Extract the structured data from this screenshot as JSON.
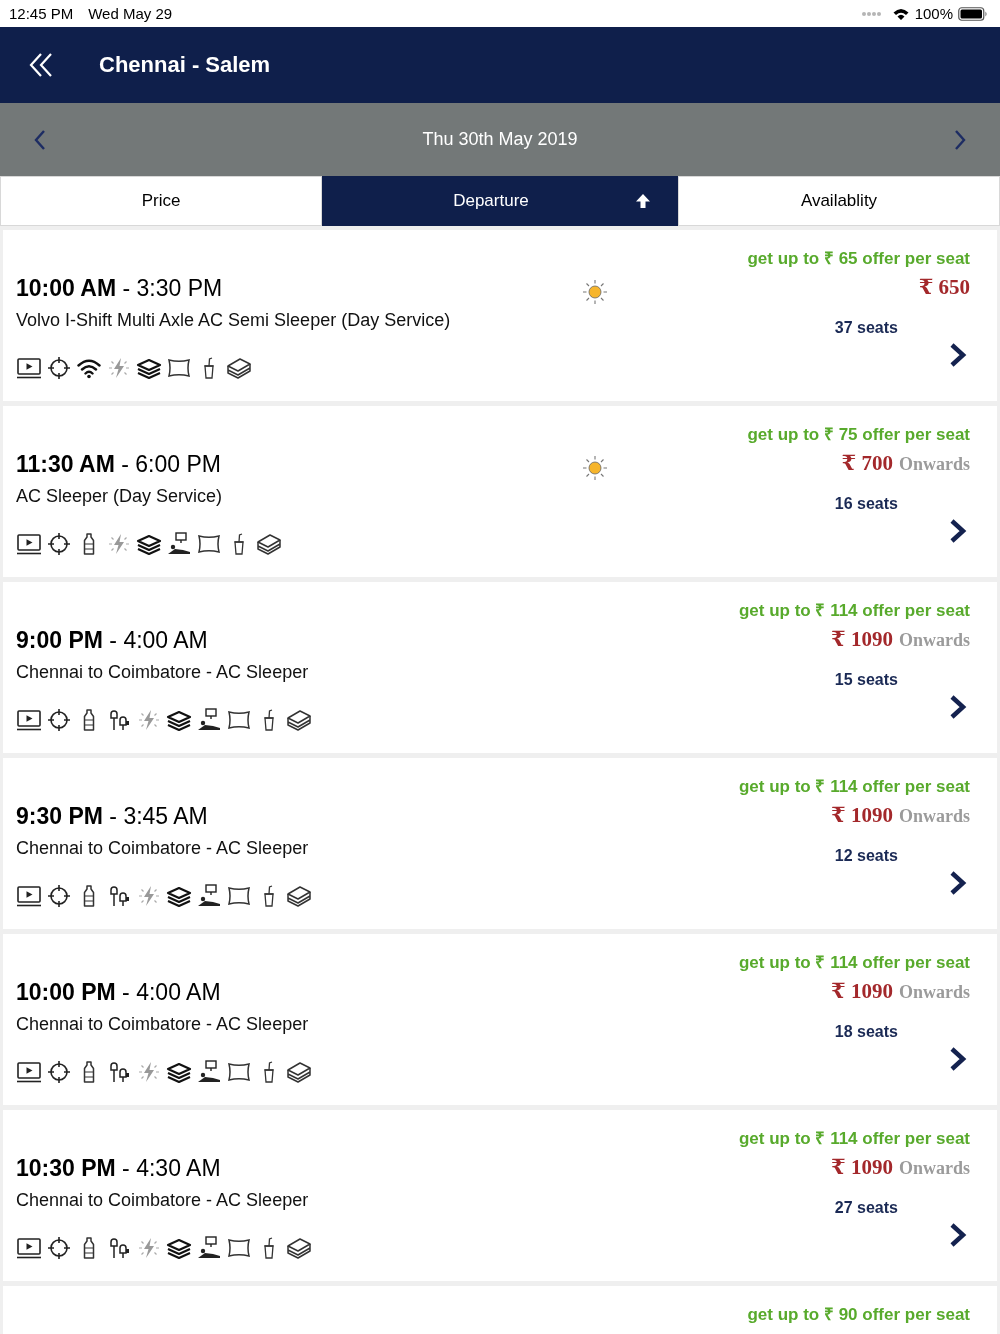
{
  "status_bar": {
    "time": "12:45 PM",
    "date": "Wed May 29",
    "battery": "100%"
  },
  "header": {
    "title": "Chennai - Salem"
  },
  "date_bar": {
    "date": "Thu 30th May 2019"
  },
  "tabs": [
    {
      "label": "Price",
      "selected": false
    },
    {
      "label": "Departure",
      "selected": true,
      "sort_ascending": true
    },
    {
      "label": "Availablity",
      "selected": false
    }
  ],
  "trips": [
    {
      "time": "**10:00 AM** - 3:30 PM",
      "bus": "Volvo I-Shift Multi Axle AC Semi Sleeper (Day Service)",
      "daytime": true,
      "amenities": [
        {
          "kind": "tv"
        },
        {
          "kind": "gps"
        },
        {
          "kind": "wifi"
        },
        {
          "kind": "charging"
        },
        {
          "kind": "blanket"
        },
        {
          "kind": "pillow"
        },
        {
          "kind": "drink"
        },
        {
          "kind": "snack"
        }
      ],
      "offer": "get up to ₹ 65 offer per seat",
      "price": "₹ 650",
      "seats": "37 seats"
    },
    {
      "time": "**11:30 AM** - 6:00 PM",
      "bus": "AC Sleeper (Day Service)",
      "daytime": true,
      "amenities": [
        {
          "kind": "tv"
        },
        {
          "kind": "gps"
        },
        {
          "kind": "water"
        },
        {
          "kind": "charging"
        },
        {
          "kind": "blanket"
        },
        {
          "kind": "berth_screen"
        },
        {
          "kind": "pillow"
        },
        {
          "kind": "drink"
        },
        {
          "kind": "snack"
        }
      ],
      "offer": "get up to ₹ 75 offer per seat",
      "price": "₹ 700",
      "price_suffix": "Onwards",
      "seats": "16 seats"
    },
    {
      "time": "**9:00 PM** - 4:00 AM",
      "bus": "Chennai to Coimbatore - AC Sleeper",
      "daytime": false,
      "amenities": [
        {
          "kind": "tv"
        },
        {
          "kind": "gps"
        },
        {
          "kind": "water"
        },
        {
          "kind": "earphones"
        },
        {
          "kind": "charging"
        },
        {
          "kind": "blanket"
        },
        {
          "kind": "berth_screen"
        },
        {
          "kind": "pillow"
        },
        {
          "kind": "drink"
        },
        {
          "kind": "snack"
        }
      ],
      "offer": "get up to ₹ 114 offer per seat",
      "price": "₹ 1090",
      "price_suffix": "Onwards",
      "seats": "15 seats"
    },
    {
      "time": "**9:30 PM** - 3:45 AM",
      "bus": "Chennai to Coimbatore - AC Sleeper",
      "daytime": false,
      "amenities": [
        {
          "kind": "tv"
        },
        {
          "kind": "gps"
        },
        {
          "kind": "water"
        },
        {
          "kind": "earphones"
        },
        {
          "kind": "charging"
        },
        {
          "kind": "blanket"
        },
        {
          "kind": "berth_screen"
        },
        {
          "kind": "pillow"
        },
        {
          "kind": "drink"
        },
        {
          "kind": "snack"
        }
      ],
      "offer": "get up to ₹ 114 offer per seat",
      "price": "₹ 1090",
      "price_suffix": "Onwards",
      "seats": "12 seats"
    },
    {
      "time": "**10:00 PM** - 4:00 AM",
      "bus": "Chennai to Coimbatore - AC Sleeper",
      "daytime": false,
      "amenities": [
        {
          "kind": "tv"
        },
        {
          "kind": "gps"
        },
        {
          "kind": "water"
        },
        {
          "kind": "earphones"
        },
        {
          "kind": "charging"
        },
        {
          "kind": "blanket"
        },
        {
          "kind": "berth_screen"
        },
        {
          "kind": "pillow"
        },
        {
          "kind": "drink"
        },
        {
          "kind": "snack"
        }
      ],
      "offer": "get up to ₹ 114 offer per seat",
      "price": "₹ 1090",
      "price_suffix": "Onwards",
      "seats": "18 seats"
    },
    {
      "time": "**10:30 PM** - 4:30 AM",
      "bus": "Chennai to Coimbatore - AC Sleeper",
      "daytime": false,
      "amenities": [
        {
          "kind": "tv"
        },
        {
          "kind": "gps"
        },
        {
          "kind": "water"
        },
        {
          "kind": "earphones"
        },
        {
          "kind": "charging"
        },
        {
          "kind": "blanket"
        },
        {
          "kind": "berth_screen"
        },
        {
          "kind": "pillow"
        },
        {
          "kind": "drink"
        },
        {
          "kind": "snack"
        }
      ],
      "offer": "get up to ₹ 114 offer per seat",
      "price": "₹ 1090",
      "price_suffix": "Onwards",
      "seats": "27 seats"
    },
    {
      "offer": "get up to ₹ 90 offer per seat"
    }
  ]
}
